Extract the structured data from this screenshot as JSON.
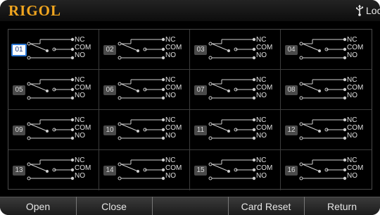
{
  "header": {
    "logo_text": "RIGOL",
    "usb_icon": "usb-icon",
    "status": "Local"
  },
  "relay_grid": {
    "selected": "01",
    "terminal_labels": {
      "nc": "NC",
      "com": "COM",
      "no": "NO"
    },
    "channels": [
      "01",
      "02",
      "03",
      "04",
      "05",
      "06",
      "07",
      "08",
      "09",
      "10",
      "11",
      "12",
      "13",
      "14",
      "15",
      "16"
    ]
  },
  "softkeys": [
    "Open",
    "Close",
    "",
    "Card Reset",
    "Return"
  ],
  "colors": {
    "logo": "#f0a51f",
    "selection": "#2d78d4",
    "background": "#000000"
  }
}
